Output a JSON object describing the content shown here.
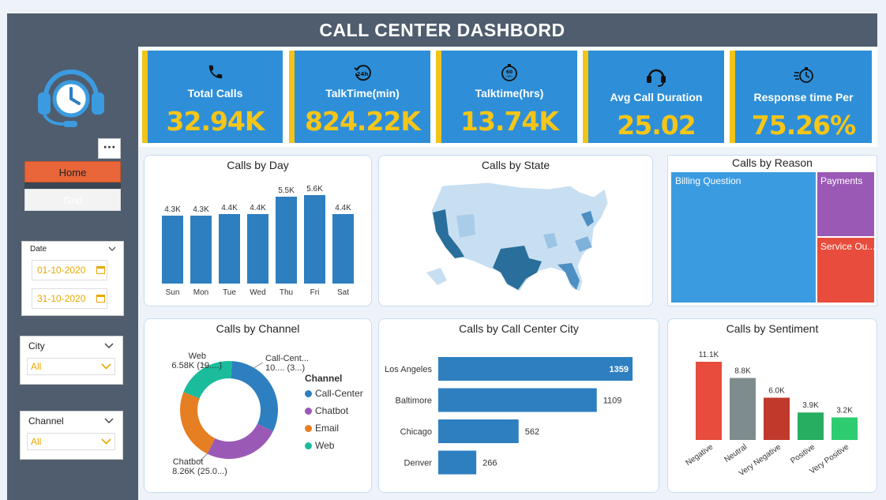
{
  "header": {
    "title": "CALL CENTER DASHBORD"
  },
  "sidebar": {
    "more_label": "···",
    "nav": [
      {
        "label": "Home"
      },
      {
        "label": "Grid"
      }
    ],
    "date_slicer": {
      "title": "Date",
      "start": "01-10-2020",
      "end": "31-10-2020"
    },
    "city_slicer": {
      "title": "City",
      "value": "All"
    },
    "channel_slicer": {
      "title": "Channel",
      "value": "All"
    }
  },
  "kpis": [
    {
      "label": "Total Calls",
      "value": "32.94K",
      "icon": "phone-icon"
    },
    {
      "label": "TalkTime(min)",
      "value": "824.22K",
      "icon": "clock-24h-icon"
    },
    {
      "label": "Talktime(hrs)",
      "value": "13.74K",
      "icon": "stopwatch-60min-icon"
    },
    {
      "label": "Avg Call Duration",
      "value": "25.02",
      "icon": "headset-icon"
    },
    {
      "label": "Response time Per",
      "value": "75.26%",
      "icon": "fast-timer-icon"
    }
  ],
  "colors": {
    "bar": "#2e7fc0",
    "kpi_bg": "#2e8fd8",
    "kpi_accent": "#f0c419",
    "sidebar": "#4f5d6e",
    "home_btn": "#e8663a"
  },
  "charts": {
    "day": {
      "title": "Calls by Day",
      "chart_data": {
        "type": "bar",
        "categories": [
          "Sun",
          "Mon",
          "Tue",
          "Wed",
          "Thu",
          "Fri",
          "Sat"
        ],
        "values": [
          4.3,
          4.3,
          4.4,
          4.4,
          5.5,
          5.6,
          4.4
        ],
        "labels": [
          "4.3K",
          "4.3K",
          "4.4K",
          "4.4K",
          "5.5K",
          "5.6K",
          "4.4K"
        ]
      }
    },
    "state": {
      "title": "Calls by State"
    },
    "reason": {
      "title": "Calls by Reason",
      "chart_data": {
        "type": "treemap",
        "items": [
          {
            "name": "Billing Question",
            "color": "#3b9be0"
          },
          {
            "name": "Payments",
            "color": "#9b59b6"
          },
          {
            "name": "Service Ou...",
            "color": "#e74c3c"
          }
        ]
      }
    },
    "channel": {
      "title": "Calls by Channel",
      "chart_data": {
        "type": "pie",
        "legend_title": "Channel",
        "legend": [
          "Call-Center",
          "Chatbot",
          "Email",
          "Web"
        ],
        "values": [
          10.3,
          8.26,
          7.8,
          6.58
        ],
        "colors": [
          "#2e7fc0",
          "#9b59b6",
          "#e67e22",
          "#1abc9c"
        ],
        "callouts": [
          {
            "name": "Call-Cent...",
            "detail": "10.... (3...)"
          },
          {
            "name": "Web",
            "detail": "6.58K (19....)"
          },
          {
            "name": "Chatbot",
            "detail": "8.26K (25.0...)"
          }
        ]
      }
    },
    "city": {
      "title": "Calls by Call Center City",
      "chart_data": {
        "type": "bar",
        "categories": [
          "Los Angeles",
          "Baltimore",
          "Chicago",
          "Denver"
        ],
        "values": [
          1359,
          1109,
          562,
          266
        ]
      }
    },
    "sentiment": {
      "title": "Calls by Sentiment",
      "chart_data": {
        "type": "bar",
        "categories": [
          "Negative",
          "Neutral",
          "Very Negative",
          "Positive",
          "Very Positive"
        ],
        "values": [
          11.1,
          8.8,
          6.0,
          3.9,
          3.2
        ],
        "labels": [
          "11.1K",
          "8.8K",
          "6.0K",
          "3.9K",
          "3.2K"
        ],
        "colors": [
          "#e74c3c",
          "#7f8c8d",
          "#c0392b",
          "#27ae60",
          "#2ecc71"
        ]
      }
    }
  }
}
